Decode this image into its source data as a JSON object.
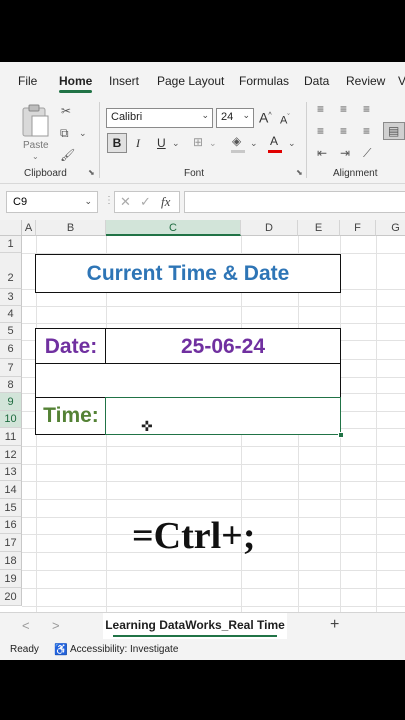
{
  "menu": {
    "tabs": [
      "File",
      "Home",
      "Insert",
      "Page Layout",
      "Formulas",
      "Data",
      "Review",
      "V"
    ],
    "active": "Home"
  },
  "ribbon": {
    "clipboard": {
      "paste_label": "Paste",
      "group_label": "Clipboard"
    },
    "font": {
      "font_name": "Calibri",
      "font_size": "24",
      "bold": "B",
      "italic": "I",
      "underline": "U",
      "grow": "A",
      "shrink": "A",
      "font_color_letter": "A",
      "group_label": "Font"
    },
    "alignment": {
      "group_label": "Alignment"
    }
  },
  "formula_bar": {
    "name_box": "C9",
    "fx_label": "fx",
    "formula": ""
  },
  "columns": [
    "A",
    "B",
    "C",
    "D",
    "E",
    "F",
    "G"
  ],
  "selected_column": "C",
  "rows": [
    "1",
    "2",
    "3",
    "4",
    "5",
    "6",
    "7",
    "8",
    "9",
    "10",
    "11",
    "12",
    "13",
    "14",
    "15",
    "16",
    "17",
    "18",
    "19",
    "20"
  ],
  "selected_rows": [
    "9",
    "10"
  ],
  "sheet": {
    "title": "Current Time & Date",
    "date_label": "Date:",
    "date_value": "25-06-24",
    "time_label": "Time:",
    "time_value": "",
    "shortcut": "=Ctrl+;"
  },
  "colors": {
    "title": "#2e75b6",
    "date": "#7030a0",
    "time": "#548235",
    "accent": "#217346"
  },
  "sheet_tabs": {
    "active": "Learning DataWorks_Real Time",
    "add": "+",
    "prev": "<",
    "next": ">"
  },
  "status_bar": {
    "mode": "Ready",
    "accessibility": "Accessibility: Investigate"
  }
}
